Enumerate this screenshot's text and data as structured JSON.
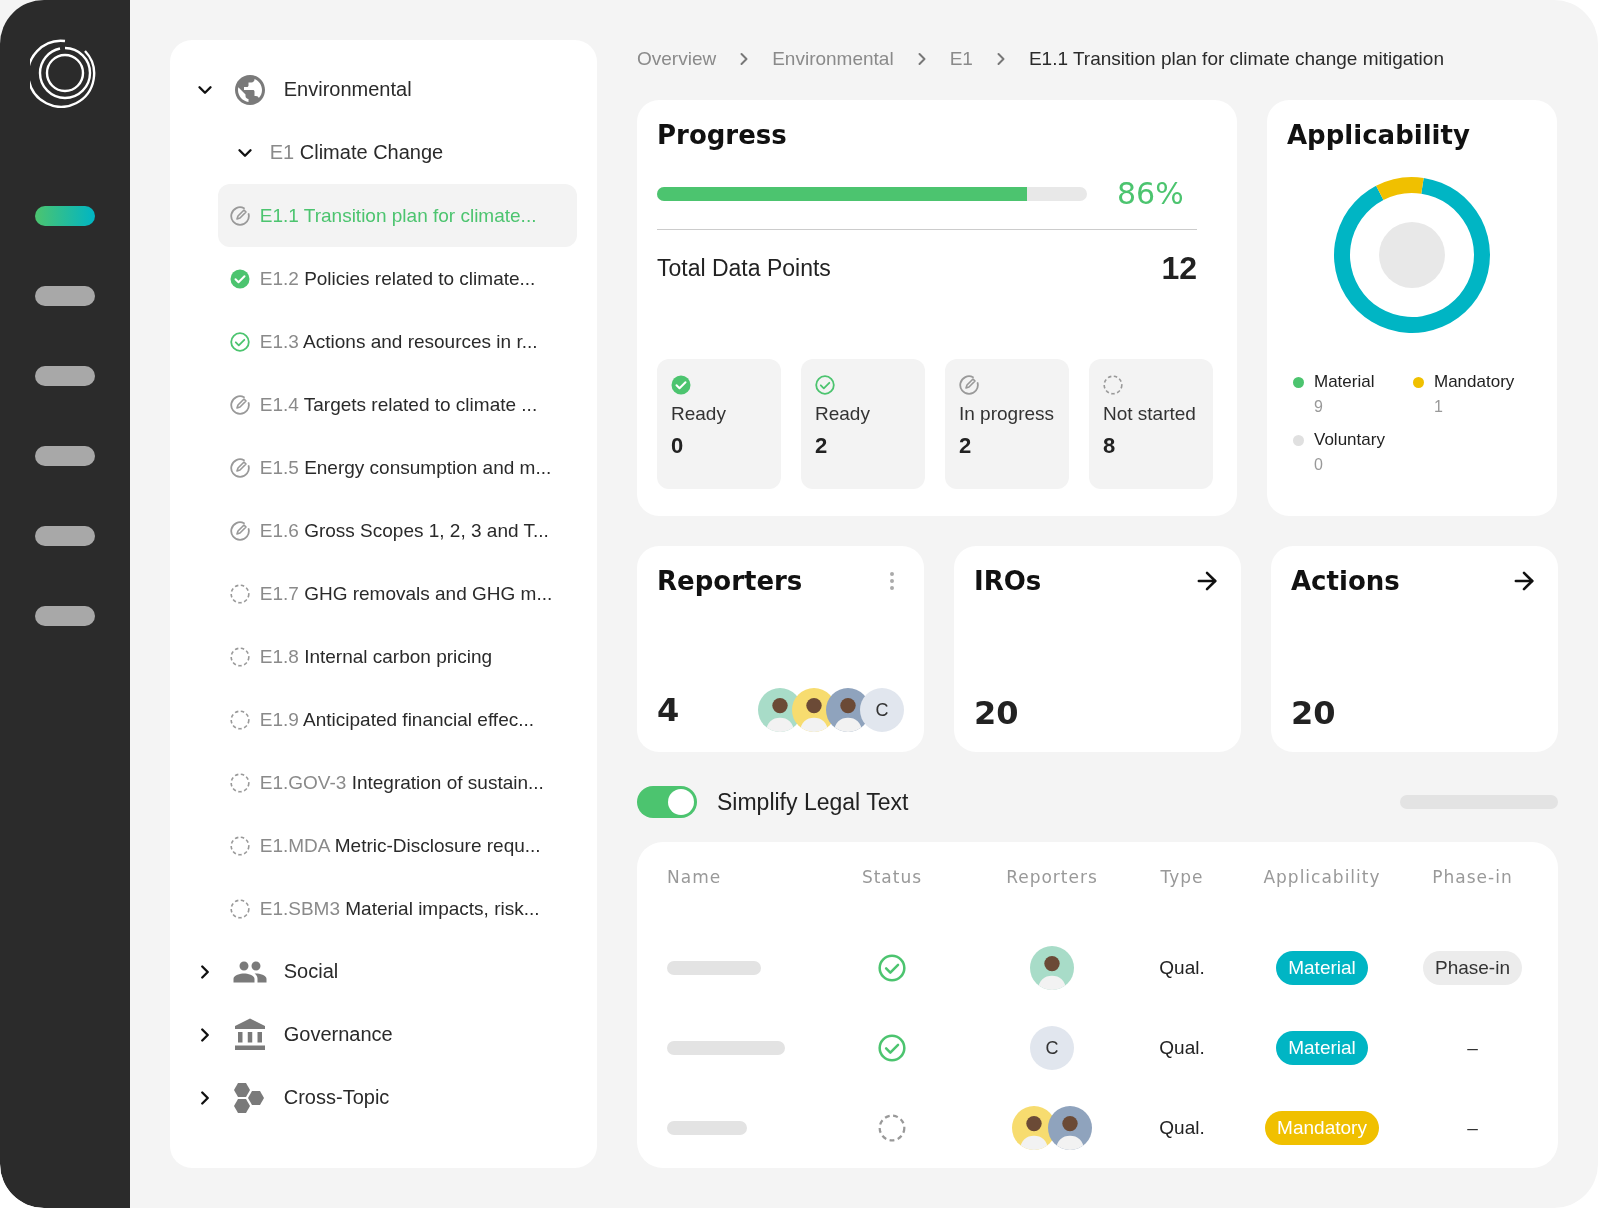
{
  "nav": [
    {
      "selected": true
    },
    {
      "selected": false
    },
    {
      "selected": false
    },
    {
      "selected": false
    },
    {
      "selected": false
    },
    {
      "selected": false
    }
  ],
  "tree": [
    {
      "kind": "globe",
      "label": "Environmental",
      "expanded": true,
      "children": [
        {
          "code": "E1",
          "label": "Climate Change",
          "expanded": true,
          "children": [
            {
              "code": "E1.1",
              "label": "Transition plan for climate...",
              "kind": "in_progress",
              "selected": true
            },
            {
              "code": "E1.2",
              "label": "Policies related to climate...",
              "kind": "done",
              "selected": false
            },
            {
              "code": "E1.3",
              "label": "Actions and resources in r...",
              "kind": "ready",
              "selected": false
            },
            {
              "code": "E1.4",
              "label": "Targets related to climate ...",
              "kind": "in_progress",
              "selected": false
            },
            {
              "code": "E1.5",
              "label": "Energy consumption and m...",
              "kind": "in_progress",
              "selected": false
            },
            {
              "code": "E1.6",
              "label": "Gross Scopes 1, 2, 3 and T...",
              "kind": "in_progress",
              "selected": false
            },
            {
              "code": "E1.7",
              "label": "GHG removals and GHG m...",
              "kind": "not_started",
              "selected": false
            },
            {
              "code": "E1.8",
              "label": "Internal carbon pricing",
              "kind": "not_started",
              "selected": false
            },
            {
              "code": "E1.9",
              "label": "Anticipated financial effec...",
              "kind": "not_started",
              "selected": false
            },
            {
              "code": "E1.GOV-3",
              "label": "Integration of sustain...",
              "kind": "not_started",
              "selected": false
            },
            {
              "code": "E1.MDA",
              "label": "Metric-Disclosure requ...",
              "kind": "not_started",
              "selected": false
            },
            {
              "code": "E1.SBM3",
              "label": "Material impacts, risk...",
              "kind": "not_started",
              "selected": false
            }
          ]
        }
      ]
    },
    {
      "kind": "people",
      "label": "Social",
      "expanded": false
    },
    {
      "kind": "bank",
      "label": "Governance",
      "expanded": false
    },
    {
      "kind": "hexagons",
      "label": "Cross-Topic",
      "expanded": false
    }
  ],
  "breadcrumb": [
    {
      "label": "Overview",
      "selected": false
    },
    {
      "label": "Environmental",
      "selected": false
    },
    {
      "label": "E1",
      "selected": false
    },
    {
      "label": "E1.1 Transition plan for climate change mitigation",
      "selected": true
    }
  ],
  "progress": {
    "title": "Progress",
    "level": 0.86,
    "percent": "86%",
    "total_label": "Total Data Points",
    "total": "12",
    "tiles": [
      {
        "kind": "done",
        "label": "Ready",
        "count": "0"
      },
      {
        "kind": "ready",
        "label": "Ready",
        "count": "2"
      },
      {
        "kind": "in_progress",
        "label": "In progress",
        "count": "2"
      },
      {
        "kind": "not_started",
        "label": "Not started",
        "count": "8"
      }
    ]
  },
  "applicability": {
    "title": "Applicability",
    "chart_data": {
      "type": "donut",
      "categories": [
        "Material",
        "Mandatory",
        "Voluntary"
      ],
      "values": [
        90,
        10,
        0
      ]
    },
    "legend": [
      {
        "count": "9",
        "color": "#4cc46f"
      },
      {
        "count": "1",
        "color": "#f0c000"
      },
      {
        "count": "0",
        "color": "#e0e0e0"
      }
    ]
  },
  "reporters": {
    "title": "Reporters",
    "count": "4",
    "avatars": [
      {
        "kind": "photo",
        "color": "#a8dcc8"
      },
      {
        "kind": "photo",
        "color": "#f7dc6f"
      },
      {
        "kind": "photo",
        "color": "#8fa3bd"
      },
      {
        "kind": "initial",
        "text": "C"
      }
    ]
  },
  "link_cards": [
    {
      "title": "IROs",
      "count": "20"
    },
    {
      "title": "Actions",
      "count": "20"
    }
  ],
  "simplify": {
    "label": "Simplify Legal Text",
    "on": true
  },
  "table": {
    "columns": [
      "Name",
      "Status",
      "Reporters",
      "Type",
      "Applicability",
      "Phase-in"
    ],
    "rows": [
      {
        "status": {
          "kind": "ready"
        },
        "reporters": [
          {
            "kind": "photo",
            "color": "#a8dcc8"
          }
        ],
        "type": "Qual.",
        "applicability": {
          "label": "Material",
          "color": "#00b5c4"
        },
        "phase_in": {
          "kind": "tag",
          "text": "Phase-in"
        }
      },
      {
        "status": {
          "kind": "ready"
        },
        "reporters": [
          {
            "kind": "initial",
            "text": "C"
          }
        ],
        "type": "Qual.",
        "applicability": {
          "label": "Material",
          "color": "#00b5c4"
        },
        "phase_in": {
          "kind": "plain",
          "text": "–"
        }
      },
      {
        "status": {
          "kind": "not_started"
        },
        "reporters": [
          {
            "kind": "photo",
            "color": "#f7dc6f"
          },
          {
            "kind": "photo",
            "color": "#8fa3bd"
          }
        ],
        "type": "Qual.",
        "applicability": {
          "label": "Mandatory",
          "color": "#f0c000"
        },
        "phase_in": {
          "kind": "plain",
          "text": "–"
        }
      }
    ]
  }
}
